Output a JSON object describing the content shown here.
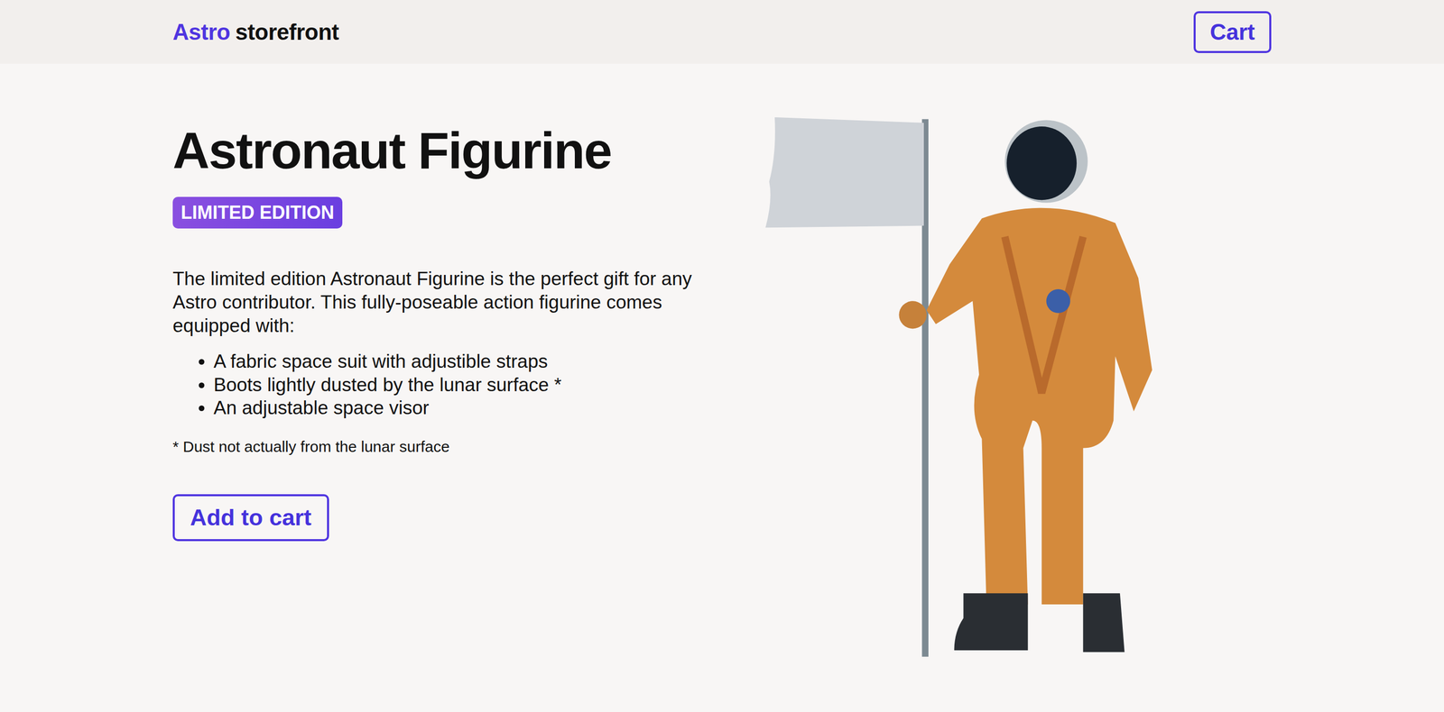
{
  "header": {
    "logo": {
      "brand": "Astro",
      "rest": "storefront"
    },
    "cart_button": "Cart"
  },
  "product": {
    "title": "Astronaut Figurine",
    "badge": "LIMITED EDITION",
    "description": "The limited edition Astronaut Figurine is the perfect gift for any Astro contributor. This fully-poseable action figurine comes equipped with:",
    "features": [
      "A fabric space suit with adjustible straps",
      "Boots lightly dusted by the lunar surface *",
      "An adjustable space visor"
    ],
    "footnote": "* Dust not actually from the lunar surface",
    "add_button": "Add to cart"
  }
}
